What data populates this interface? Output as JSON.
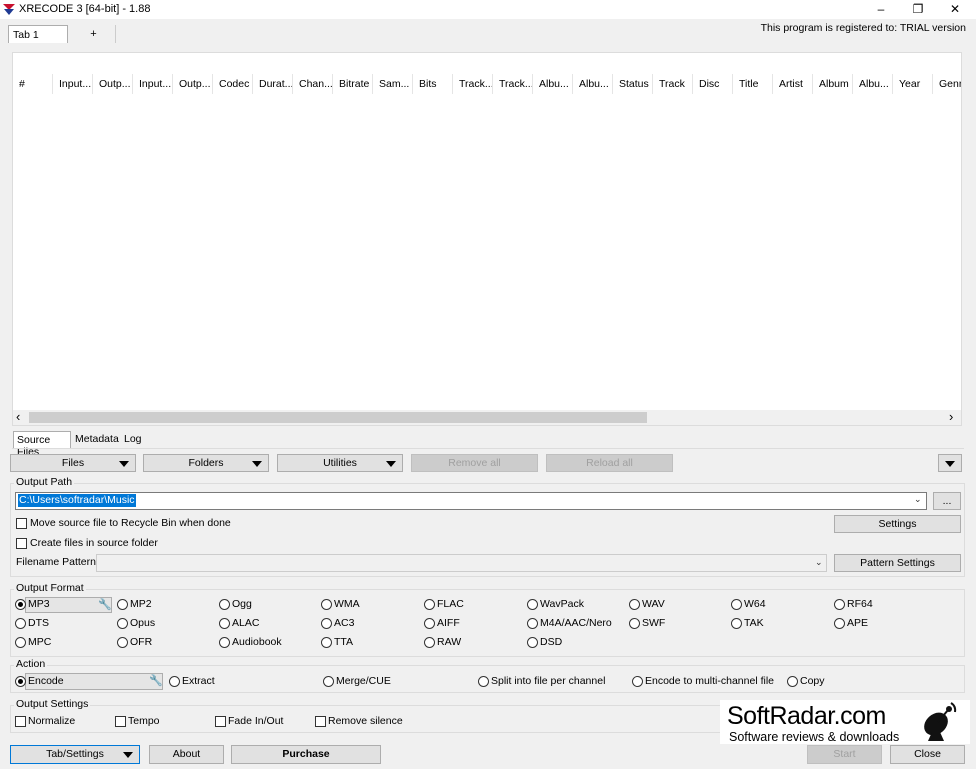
{
  "window": {
    "title": "XRECODE 3 [64-bit] - 1.88",
    "minimize": "–",
    "restore": "❐",
    "close": "✕"
  },
  "registration": "This program is registered to: TRIAL version",
  "tabs": {
    "tab1": "Tab 1",
    "add": "+"
  },
  "columns": [
    "#",
    "Input...",
    "Outp...",
    "Input...",
    "Outp...",
    "Codec",
    "Durat...",
    "Chan...",
    "Bitrate",
    "Sam...",
    "Bits",
    "Track...",
    "Track...",
    "Albu...",
    "Albu...",
    "Status",
    "Track",
    "Disc",
    "Title",
    "Artist",
    "Album",
    "Albu...",
    "Year",
    "Genr"
  ],
  "scroll": {
    "left": "‹",
    "right": "›"
  },
  "subtabs": {
    "source_files": "Source Files",
    "metadata": "Metadata",
    "log": "Log"
  },
  "toolbar": {
    "files": "Files",
    "folders": "Folders",
    "utilities": "Utilities",
    "remove_all": "Remove all",
    "reload_all": "Reload all"
  },
  "output_path": {
    "label": "Output Path",
    "value": "C:\\Users\\softradar\\Music",
    "dropdown": "⌄",
    "browse": "...",
    "move_source": "Move source file to Recycle Bin when done",
    "create_in_source": "Create files in source folder",
    "settings": "Settings",
    "filename_pattern_label": "Filename Pattern:",
    "pattern_settings": "Pattern Settings"
  },
  "output_format": {
    "label": "Output Format",
    "selected": "MP3",
    "options": [
      "MP3",
      "MP2",
      "Ogg",
      "WMA",
      "FLAC",
      "WavPack",
      "WAV",
      "W64",
      "RF64",
      "DTS",
      "Opus",
      "ALAC",
      "AC3",
      "AIFF",
      "M4A/AAC/Nero",
      "SWF",
      "TAK",
      "APE",
      "MPC",
      "OFR",
      "Audiobook",
      "TTA",
      "RAW",
      "DSD"
    ]
  },
  "action": {
    "label": "Action",
    "selected": "Encode",
    "options": [
      "Encode",
      "Extract",
      "Merge/CUE",
      "Split into file per channel",
      "Encode to multi-channel file",
      "Copy"
    ]
  },
  "output_settings": {
    "label": "Output Settings",
    "options": [
      "Normalize",
      "Tempo",
      "Fade In/Out",
      "Remove silence"
    ]
  },
  "bottom": {
    "tab_settings": "Tab/Settings",
    "about": "About",
    "purchase": "Purchase",
    "start": "Start",
    "close": "Close"
  },
  "watermark": {
    "brand": "SoftRadar.com",
    "tagline": "Software reviews & downloads"
  },
  "colors": {
    "selection": "#0078d7",
    "window_bg": "#f0f0f0",
    "button": "#e1e1e1",
    "logo_red": "#c8102e",
    "logo_blue": "#1f3a93"
  }
}
